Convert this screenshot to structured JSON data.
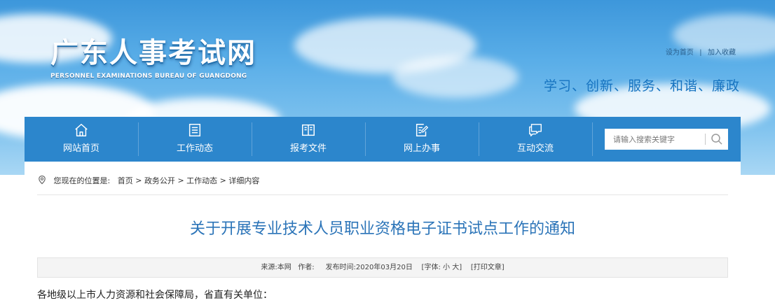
{
  "header": {
    "logo_cn": "广东人事考试网",
    "logo_en": "PERSONNEL EXAMINATIONS BUREAU OF GUANGDONG",
    "top_links": {
      "set_home": "设为首页",
      "separator": "|",
      "add_favorite": "加入收藏"
    },
    "slogan": "学习、创新、服务、和谐、廉政"
  },
  "nav": {
    "items": [
      {
        "label": "网站首页",
        "icon": "home-icon"
      },
      {
        "label": "工作动态",
        "icon": "news-list-icon"
      },
      {
        "label": "报考文件",
        "icon": "open-book-icon"
      },
      {
        "label": "网上办事",
        "icon": "edit-form-icon"
      },
      {
        "label": "互动交流",
        "icon": "chat-bubbles-icon"
      }
    ],
    "search": {
      "placeholder": "请输入搜索关键字",
      "icon": "search-icon"
    }
  },
  "breadcrumb": {
    "prefix": "您现在的位置是:",
    "items": [
      "首页",
      "政务公开",
      "工作动态",
      "详细内容"
    ],
    "separator": ">",
    "icon": "location-pin-icon"
  },
  "article": {
    "title": "关于开展专业技术人员职业资格电子证书试点工作的通知",
    "meta": {
      "source_label": "来源:",
      "source": "本网",
      "author_label": "作者:",
      "author": "",
      "date_label": "发布时间:",
      "date": "2020年03月20日",
      "font_label": "[字体:",
      "font_small": "小",
      "font_large": "大]",
      "print": "[打印文章]"
    },
    "greeting": "各地级以上市人力资源和社会保障局，省直有关单位："
  },
  "colors": {
    "nav_bg": "#2c86cc",
    "title": "#2b74b8",
    "slogan": "#1673c0"
  }
}
